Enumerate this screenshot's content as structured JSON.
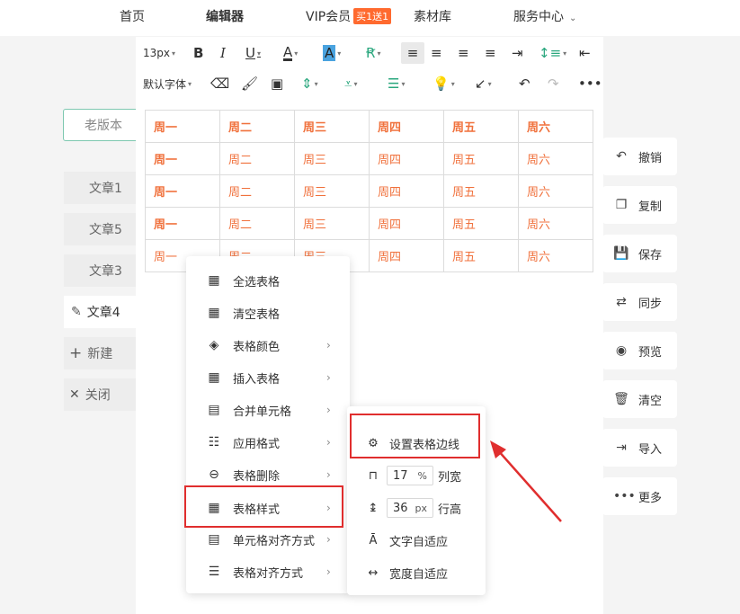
{
  "nav": {
    "items": [
      "首页",
      "编辑器",
      "VIP会员",
      "素材库",
      "服务中心"
    ],
    "vip_badge": "买1送1"
  },
  "toolbar": {
    "font_size": "13px",
    "font_family": "默认字体"
  },
  "table": {
    "header": [
      "周一",
      "周二",
      "周三",
      "周四",
      "周五",
      "周六"
    ],
    "rows": [
      [
        "周一",
        "周二",
        "周三",
        "周四",
        "周五",
        "周六"
      ],
      [
        "周一",
        "周二",
        "周三",
        "周四",
        "周五",
        "周六"
      ],
      [
        "周一",
        "周二",
        "周三",
        "周四",
        "周五",
        "周六"
      ],
      [
        "周一",
        "周二",
        "周三",
        "周四",
        "周五",
        "周六"
      ]
    ],
    "accent_color": "#f0713c"
  },
  "left_sidebar": {
    "old_version": "老版本",
    "docs": [
      "文章1",
      "文章5",
      "文章3",
      "文章4"
    ],
    "new": "新建",
    "close": "关闭"
  },
  "right_sidebar": {
    "items": [
      "撤销",
      "复制",
      "保存",
      "同步",
      "预览",
      "清空",
      "导入",
      "更多"
    ]
  },
  "context_menu": {
    "items": [
      "全选表格",
      "清空表格",
      "表格颜色",
      "插入表格",
      "合并单元格",
      "应用格式",
      "表格删除",
      "表格样式",
      "单元格对齐方式",
      "表格对齐方式"
    ]
  },
  "submenu": {
    "border": "设置表格边线",
    "col_width_value": "17",
    "col_width_unit": "%",
    "col_width_label": "列宽",
    "row_height_value": "36",
    "row_height_unit": "px",
    "row_height_label": "行高",
    "text_fit": "文字自适应",
    "width_fit": "宽度自适应"
  },
  "highlight_color": "#e02e2e"
}
